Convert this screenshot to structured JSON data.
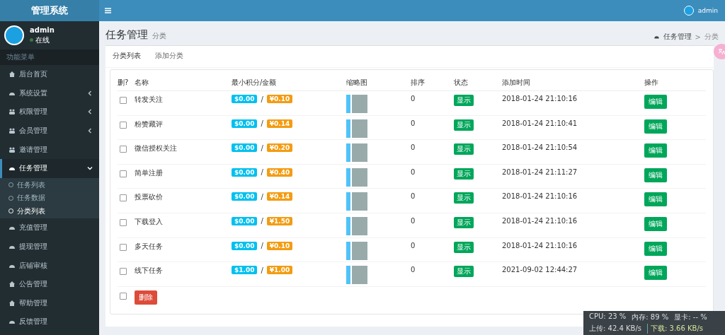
{
  "brand": "管理系统",
  "topbar": {
    "username": "admin"
  },
  "user_panel": {
    "name": "admin",
    "status": "在线"
  },
  "sidebar": {
    "header": "功能菜单",
    "items": [
      {
        "label": "后台首页",
        "kind": "home",
        "selected": false
      },
      {
        "label": "系统设置",
        "kind": "dashboard",
        "expanded": false,
        "selected": false
      },
      {
        "label": "权限管理",
        "kind": "users",
        "expanded": false,
        "selected": false
      },
      {
        "label": "会员管理",
        "kind": "users",
        "expanded": false,
        "selected": false
      },
      {
        "label": "邀请管理",
        "kind": "users",
        "selected": false
      },
      {
        "label": "任务管理",
        "kind": "dashboard",
        "expanded": true,
        "selected": true,
        "children": [
          {
            "label": "任务列表",
            "selected": false
          },
          {
            "label": "任务数据",
            "selected": false
          },
          {
            "label": "分类列表",
            "selected": true
          }
        ]
      },
      {
        "label": "充值管理",
        "kind": "dashboard",
        "selected": false
      },
      {
        "label": "提现管理",
        "kind": "dashboard",
        "selected": false
      },
      {
        "label": "店铺审核",
        "kind": "dashboard",
        "selected": false
      },
      {
        "label": "公告管理",
        "kind": "home",
        "selected": false
      },
      {
        "label": "帮助管理",
        "kind": "home",
        "selected": false
      },
      {
        "label": "反馈管理",
        "kind": "dashboard",
        "selected": false
      }
    ]
  },
  "page": {
    "title": "任务管理",
    "subtitle": "分类",
    "breadcrumb": [
      "任务管理",
      "分类"
    ],
    "breadcrumb_separator": ">"
  },
  "tabs": [
    {
      "label": "分类列表",
      "selected": true
    },
    {
      "label": "添加分类",
      "selected": false
    }
  ],
  "table": {
    "columns": [
      "删?",
      "名称",
      "最小积分/金额",
      "缩略图",
      "排序",
      "状态",
      "添加时间",
      "操作"
    ],
    "rows": [
      {
        "checked": false,
        "name": "转发关注",
        "points": "$0.00",
        "separator": "/",
        "amount": "¥0.10",
        "sort": "0",
        "status": "显示",
        "time": "2018-01-24 21:10:16",
        "action": "编辑"
      },
      {
        "checked": false,
        "name": "粉赞藏评",
        "points": "$0.00",
        "separator": "/",
        "amount": "¥0.14",
        "sort": "0",
        "status": "显示",
        "time": "2018-01-24 21:10:41",
        "action": "编辑"
      },
      {
        "checked": false,
        "name": "微信授权关注",
        "points": "$0.00",
        "separator": "/",
        "amount": "¥0.20",
        "sort": "0",
        "status": "显示",
        "time": "2018-01-24 21:10:54",
        "action": "编辑"
      },
      {
        "checked": false,
        "name": "简单注册",
        "points": "$0.00",
        "separator": "/",
        "amount": "¥0.40",
        "sort": "0",
        "status": "显示",
        "time": "2018-01-24 21:11:27",
        "action": "编辑"
      },
      {
        "checked": false,
        "name": "投票砍价",
        "points": "$0.00",
        "separator": "/",
        "amount": "¥0.14",
        "sort": "0",
        "status": "显示",
        "time": "2018-01-24 21:10:16",
        "action": "编辑"
      },
      {
        "checked": false,
        "name": "下载登入",
        "points": "$0.00",
        "separator": "/",
        "amount": "¥1.50",
        "sort": "0",
        "status": "显示",
        "time": "2018-01-24 21:10:16",
        "action": "编辑"
      },
      {
        "checked": false,
        "name": "多天任务",
        "points": "$0.00",
        "separator": "/",
        "amount": "¥0.10",
        "sort": "0",
        "status": "显示",
        "time": "2018-01-24 21:10:16",
        "action": "编辑"
      },
      {
        "checked": false,
        "name": "线下任务",
        "points": "$1.00",
        "separator": "/",
        "amount": "¥1.00",
        "sort": "0",
        "status": "显示",
        "time": "2021-09-02 12:44:27",
        "action": "编辑"
      }
    ],
    "footer": {
      "checked": false,
      "delete_label": "删除"
    }
  },
  "monitor": {
    "cpu": "CPU: 23 %",
    "memory": "内存: 89 %",
    "gpu": "显卡: -- %",
    "upload": "上传: 42.4 KB/s",
    "download": "下载: 3.66 KB/s"
  }
}
